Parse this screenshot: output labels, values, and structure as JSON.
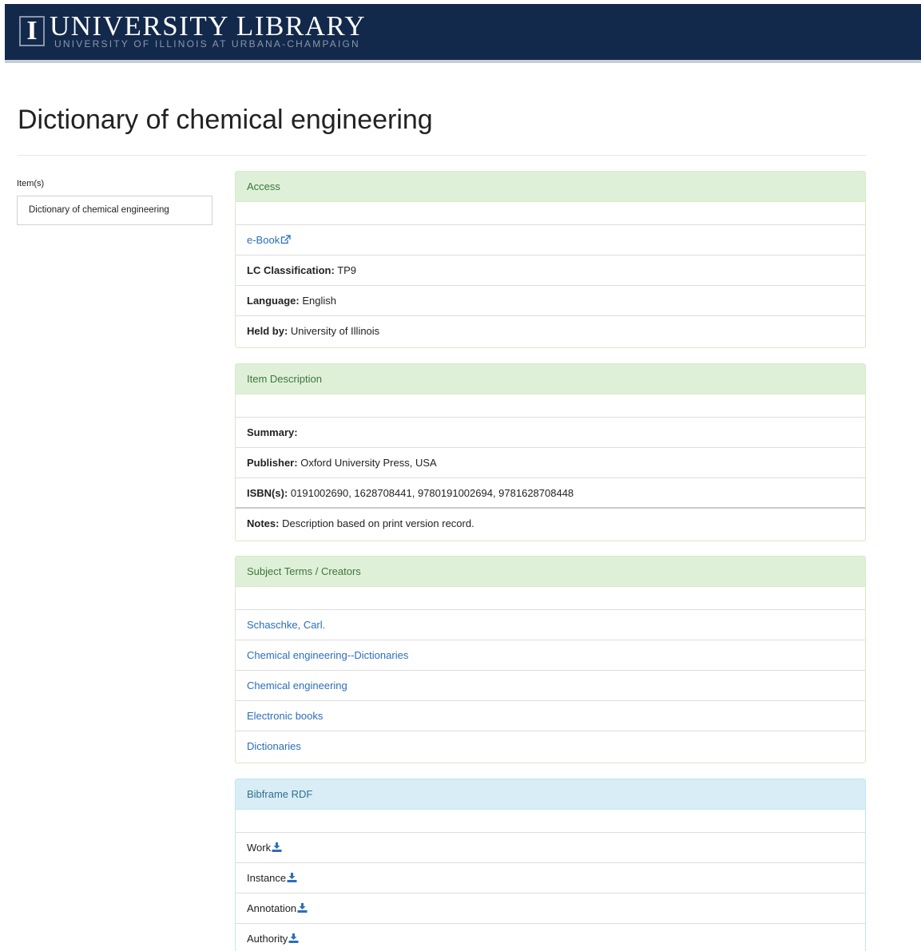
{
  "header": {
    "logo_letter": "I",
    "title": "UNIVERSITY LIBRARY",
    "subtitle": "UNIVERSITY OF ILLINOIS AT URBANA-CHAMPAIGN",
    "background_color": "#13294b"
  },
  "page_title": "Dictionary of chemical engineering",
  "sidebar": {
    "label": "Item(s)",
    "items": [
      {
        "label": "Dictionary of chemical engineering"
      }
    ]
  },
  "access": {
    "heading": "Access",
    "ebook_label": "e-Book",
    "ebook_icon": "external-link-icon",
    "lc_label": "LC Classification:",
    "lc_value": "TP9",
    "language_label": "Language:",
    "language_value": "English",
    "held_label": "Held by:",
    "held_value": "University of Illinois"
  },
  "description": {
    "heading": "Item Description",
    "summary_label": "Summary:",
    "summary_value": "",
    "publisher_label": "Publisher:",
    "publisher_value": "Oxford University Press, USA",
    "isbn_label": "ISBN(s):",
    "isbn_value": "0191002690, 1628708441, 9780191002694, 9781628708448",
    "notes_label": "Notes:",
    "notes_value": "Description based on print version record."
  },
  "subjects": {
    "heading": "Subject Terms / Creators",
    "items": [
      "Schaschke, Carl.",
      "Chemical engineering--Dictionaries",
      "Chemical engineering",
      "Electronic books",
      "Dictionaries"
    ]
  },
  "rdf": {
    "heading": "Bibframe RDF",
    "download_icon": "download-icon",
    "items": [
      "Work",
      "Instance",
      "Annotation",
      "Authority"
    ]
  },
  "colors": {
    "link": "#2a6ebb",
    "success_heading_bg": "#dff0d8",
    "success_heading_text": "#3c763d",
    "info_heading_bg": "#d9edf7",
    "info_heading_text": "#31708f"
  }
}
